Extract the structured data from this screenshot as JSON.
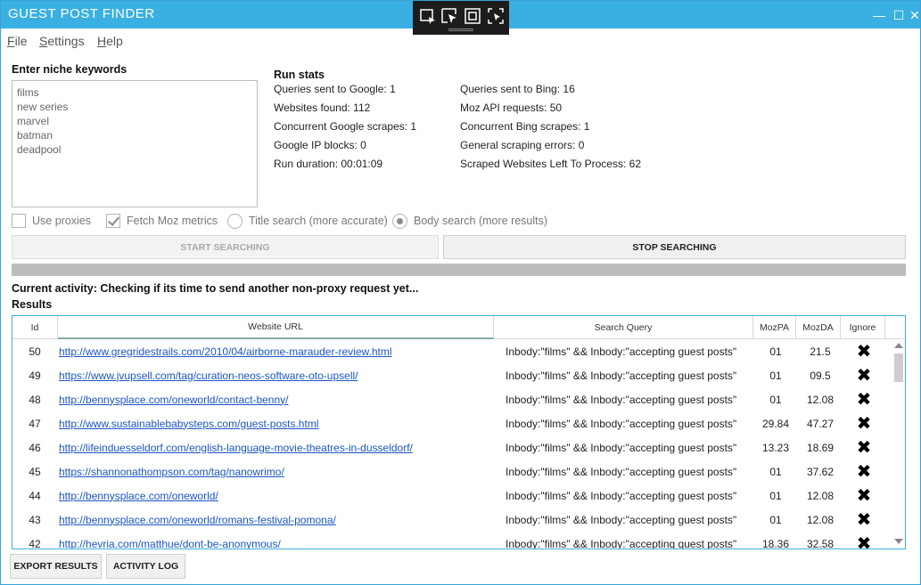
{
  "window": {
    "title": "GUEST POST FINDER",
    "min": "—",
    "max": "☐",
    "close": "✕"
  },
  "snip_toolbar": {
    "icons": [
      "snip-icon",
      "cursor-snip-icon",
      "window-snip-icon",
      "fullscreen-snip-icon"
    ]
  },
  "menu": {
    "file": "File",
    "settings": "Settings",
    "help": "Help"
  },
  "keywords": {
    "label": "Enter niche keywords",
    "lines": [
      "films",
      "new series",
      "marvel",
      "batman",
      "deadpool"
    ]
  },
  "run_stats": {
    "label": "Run stats",
    "google_queries": "Queries sent to Google: 1",
    "websites_found": "Websites found: 112",
    "concurrent_google": "Concurrent Google scrapes: 1",
    "google_ip_blocks": "Google IP blocks: 0",
    "run_duration": "Run duration: 00:01:09",
    "bing_queries": "Queries sent to Bing: 16",
    "moz_requests": "Moz API requests: 50",
    "concurrent_bing": "Concurrent Bing scrapes: 1",
    "scraping_errors": "General scraping errors: 0",
    "left_to_process": "Scraped Websites Left To Process: 62"
  },
  "options": {
    "use_proxies": "Use proxies",
    "fetch_moz": "Fetch Moz metrics",
    "title_search": "Title search (more accurate)",
    "body_search": "Body search (more results)",
    "use_proxies_checked": false,
    "fetch_moz_checked": true,
    "search_mode": "body"
  },
  "buttons": {
    "start": "START SEARCHING",
    "stop": "STOP SEARCHING",
    "export": "EXPORT RESULTS",
    "activity_log": "ACTIVITY LOG"
  },
  "activity": {
    "text": "Current activity: Checking if its time to send another non-proxy request yet..."
  },
  "results": {
    "label": "Results",
    "columns": {
      "id": "Id",
      "url": "Website URL",
      "query": "Search Query",
      "moz_pa": "MozPA",
      "moz_da": "MozDA",
      "ignore": "Ignore"
    },
    "ignore_glyph": "✖",
    "rows": [
      {
        "id": "50",
        "url": "http://www.gregridestrails.com/2010/04/airborne-marauder-review.html",
        "query": "Inbody:\"films\" && Inbody:\"accepting guest posts\"",
        "pa": "01",
        "da": "21.5"
      },
      {
        "id": "49",
        "url": "https://www.jvupsell.com/tag/curation-neos-software-oto-upsell/",
        "query": "Inbody:\"films\" && Inbody:\"accepting guest posts\"",
        "pa": "01",
        "da": "09.5"
      },
      {
        "id": "48",
        "url": "http://bennysplace.com/oneworld/contact-benny/",
        "query": "Inbody:\"films\" && Inbody:\"accepting guest posts\"",
        "pa": "01",
        "da": "12.08"
      },
      {
        "id": "47",
        "url": "http://www.sustainablebabysteps.com/guest-posts.html",
        "query": "Inbody:\"films\" && Inbody:\"accepting guest posts\"",
        "pa": "29.84",
        "da": "47.27"
      },
      {
        "id": "46",
        "url": "http://lifeinduesseldorf.com/english-language-movie-theatres-in-dusseldorf/",
        "query": "Inbody:\"films\" && Inbody:\"accepting guest posts\"",
        "pa": "13.23",
        "da": "18.69"
      },
      {
        "id": "45",
        "url": "https://shannonathompson.com/tag/nanowrimo/",
        "query": "Inbody:\"films\" && Inbody:\"accepting guest posts\"",
        "pa": "01",
        "da": "37.62"
      },
      {
        "id": "44",
        "url": "http://bennysplace.com/oneworld/",
        "query": "Inbody:\"films\" && Inbody:\"accepting guest posts\"",
        "pa": "01",
        "da": "12.08"
      },
      {
        "id": "43",
        "url": "http://bennysplace.com/oneworld/romans-festival-pomona/",
        "query": "Inbody:\"films\" && Inbody:\"accepting guest posts\"",
        "pa": "01",
        "da": "12.08"
      },
      {
        "id": "42",
        "url": "http://hevria.com/matthue/dont-be-anonymous/",
        "query": "Inbody:\"films\" && Inbody:\"accepting guest posts\"",
        "pa": "18.36",
        "da": "32.58"
      }
    ]
  },
  "colors": {
    "accent": "#3ab0e2",
    "link": "#1a56c5",
    "progress": "#bdbdbd"
  }
}
